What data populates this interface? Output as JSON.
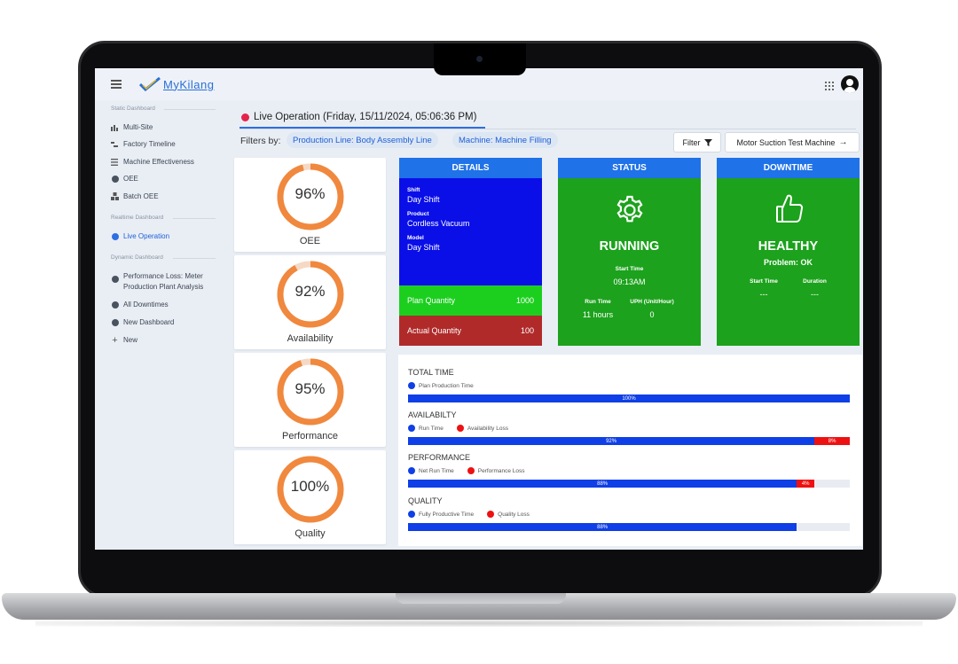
{
  "app": {
    "logo_text": "MyKilang"
  },
  "sidebar": {
    "sections": [
      {
        "title": "Static Dashboard",
        "items": [
          {
            "label": "Multi-Site",
            "icon": "bar-chart-icon"
          },
          {
            "label": "Factory Timeline",
            "icon": "timeline-icon"
          },
          {
            "label": "Machine Effectiveness",
            "icon": "list-icon"
          },
          {
            "label": "OEE",
            "icon": "gauge-icon"
          },
          {
            "label": "Batch OEE",
            "icon": "batch-icon"
          }
        ]
      },
      {
        "title": "Realtime Dashboard",
        "items": [
          {
            "label": "Live Operation",
            "icon": "live-dot-icon",
            "active": true
          }
        ]
      },
      {
        "title": "Dynamic Dashboard",
        "items": [
          {
            "label": "Performance Loss: Meter Production Plant Analysis",
            "line1": "Performance Loss: Meter",
            "line2": "Production Plant Analysis",
            "icon": "dashboard-dot-icon"
          },
          {
            "label": "All Downtimes",
            "icon": "dashboard-dot-icon"
          },
          {
            "label": "New Dashboard",
            "icon": "dashboard-dot-icon"
          },
          {
            "label": "New",
            "icon": "plus-icon"
          }
        ]
      }
    ]
  },
  "tab": {
    "label": "Live Operation (Friday, 15/11/2024, 05:06:36 PM)"
  },
  "filters": {
    "label": "Filters by:",
    "chips": [
      "Production Line: Body Assembly Line",
      "Machine: Machine Filling"
    ],
    "filter_button": "Filter",
    "machine_button": "Motor Suction Test Machine"
  },
  "kpis": [
    {
      "label": "OEE",
      "value": "96%",
      "fraction": 0.96
    },
    {
      "label": "Availability",
      "value": "92%",
      "fraction": 0.92
    },
    {
      "label": "Performance",
      "value": "95%",
      "fraction": 0.95
    },
    {
      "label": "Quality",
      "value": "100%",
      "fraction": 1.0
    }
  ],
  "details": {
    "title": "DETAILS",
    "shift_label": "Shift",
    "shift_value": "Day Shift",
    "product_label": "Product",
    "product_value": "Cordless Vacuum",
    "model_label": "Model",
    "model_value": "Day Shift",
    "plan_label": "Plan Quantity",
    "plan_value": "1000",
    "actual_label": "Actual Quantity",
    "actual_value": "100"
  },
  "status": {
    "title": "STATUS",
    "state": "RUNNING",
    "start_label": "Start Time",
    "start_value": "09:13AM",
    "run_label": "Run Time",
    "run_value": "11 hours",
    "uph_label": "UPH (Unit/Hour)",
    "uph_value": "0"
  },
  "downtime": {
    "title": "DOWNTIME",
    "state": "HEALTHY",
    "problem": "Problem: OK",
    "start_label": "Start Time",
    "start_value": "---",
    "duration_label": "Duration",
    "duration_value": "---"
  },
  "time_bars": [
    {
      "title": "TOTAL TIME",
      "legend": [
        {
          "label": "Plan Production Time",
          "color": "#0f3fe6"
        }
      ],
      "segments": [
        {
          "label": "100%",
          "value": 100,
          "color": "blue"
        }
      ]
    },
    {
      "title": "AVAILABILTY",
      "legend": [
        {
          "label": "Run Time",
          "color": "#0f3fe6"
        },
        {
          "label": "Availability Loss",
          "color": "#ee1111"
        }
      ],
      "segments": [
        {
          "label": "92%",
          "value": 92,
          "color": "blue"
        },
        {
          "label": "8%",
          "value": 8,
          "color": "red"
        }
      ]
    },
    {
      "title": "PERFORMANCE",
      "legend": [
        {
          "label": "Net Run Time",
          "color": "#0f3fe6"
        },
        {
          "label": "Performance Loss",
          "color": "#ee1111"
        }
      ],
      "segments": [
        {
          "label": "88%",
          "value": 88,
          "color": "blue"
        },
        {
          "label": "4%",
          "value": 4,
          "color": "red"
        }
      ]
    },
    {
      "title": "QUALITY",
      "legend": [
        {
          "label": "Fully Productive Time",
          "color": "#0f3fe6"
        },
        {
          "label": "Quality Loss",
          "color": "#ee1111"
        }
      ],
      "segments": [
        {
          "label": "88%",
          "value": 88,
          "color": "blue"
        }
      ]
    }
  ],
  "colors": {
    "accent": "#2f6ee0",
    "gauge": "#f0883e",
    "running": "#1ca21c"
  }
}
